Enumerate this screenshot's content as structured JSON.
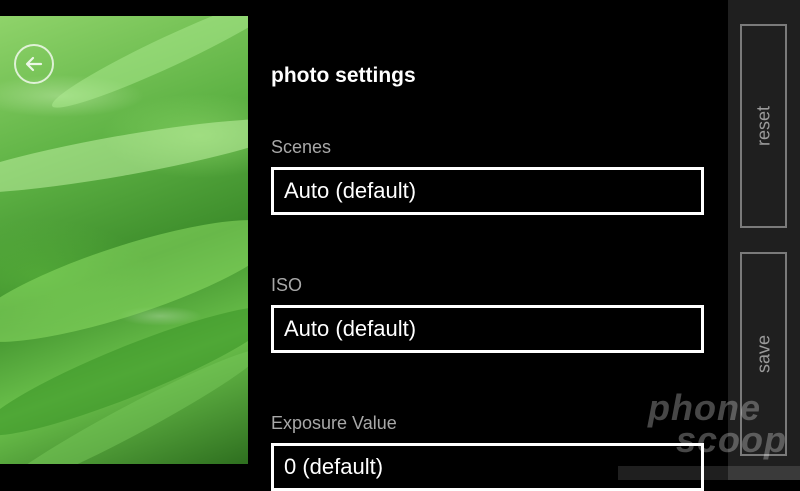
{
  "page": {
    "title": "photo settings"
  },
  "settings": [
    {
      "label": "Scenes",
      "value": "Auto (default)"
    },
    {
      "label": "ISO",
      "value": "Auto (default)"
    },
    {
      "label": "Exposure Value",
      "value": "0 (default)"
    }
  ],
  "appbar": {
    "reset_label": "reset",
    "save_label": "save"
  },
  "watermark": {
    "line1": "phone",
    "line2": "scoop"
  },
  "icons": {
    "back": "back-arrow-icon"
  },
  "colors": {
    "background": "#000000",
    "appbar": "#1f1f1f",
    "label": "#a8a8a8",
    "field_border": "#ffffff"
  }
}
